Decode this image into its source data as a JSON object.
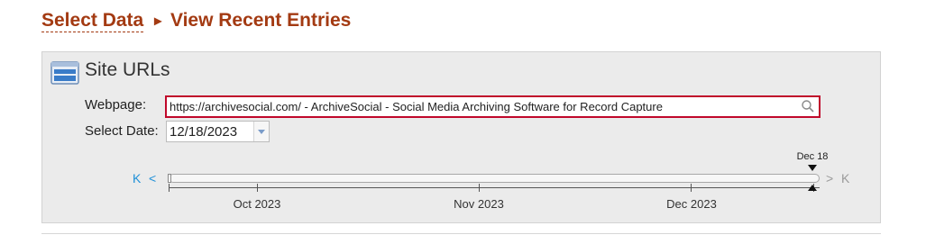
{
  "breadcrumb": {
    "select_data": "Select Data",
    "separator": "▸",
    "current": "View Recent Entries"
  },
  "panel": {
    "title": "Site URLs",
    "icon": "browser-window-icon"
  },
  "form": {
    "webpage_label": "Webpage:",
    "webpage_value": "https://archivesocial.com/ - ArchiveSocial - Social Media Archiving Software for Record Capture",
    "date_label": "Select Date:",
    "date_value": "12/18/2023"
  },
  "timeline": {
    "nav_first": "K",
    "nav_prev": "<",
    "nav_next": ">",
    "nav_last": "K",
    "months": [
      {
        "label": "Oct 2023"
      },
      {
        "label": "Nov 2023"
      },
      {
        "label": "Dec 2023"
      }
    ],
    "selected_marker": "Dec 18"
  },
  "colors": {
    "title": "#a33a12",
    "highlight_border": "#c0082b",
    "nav_active": "#1e90d8"
  }
}
